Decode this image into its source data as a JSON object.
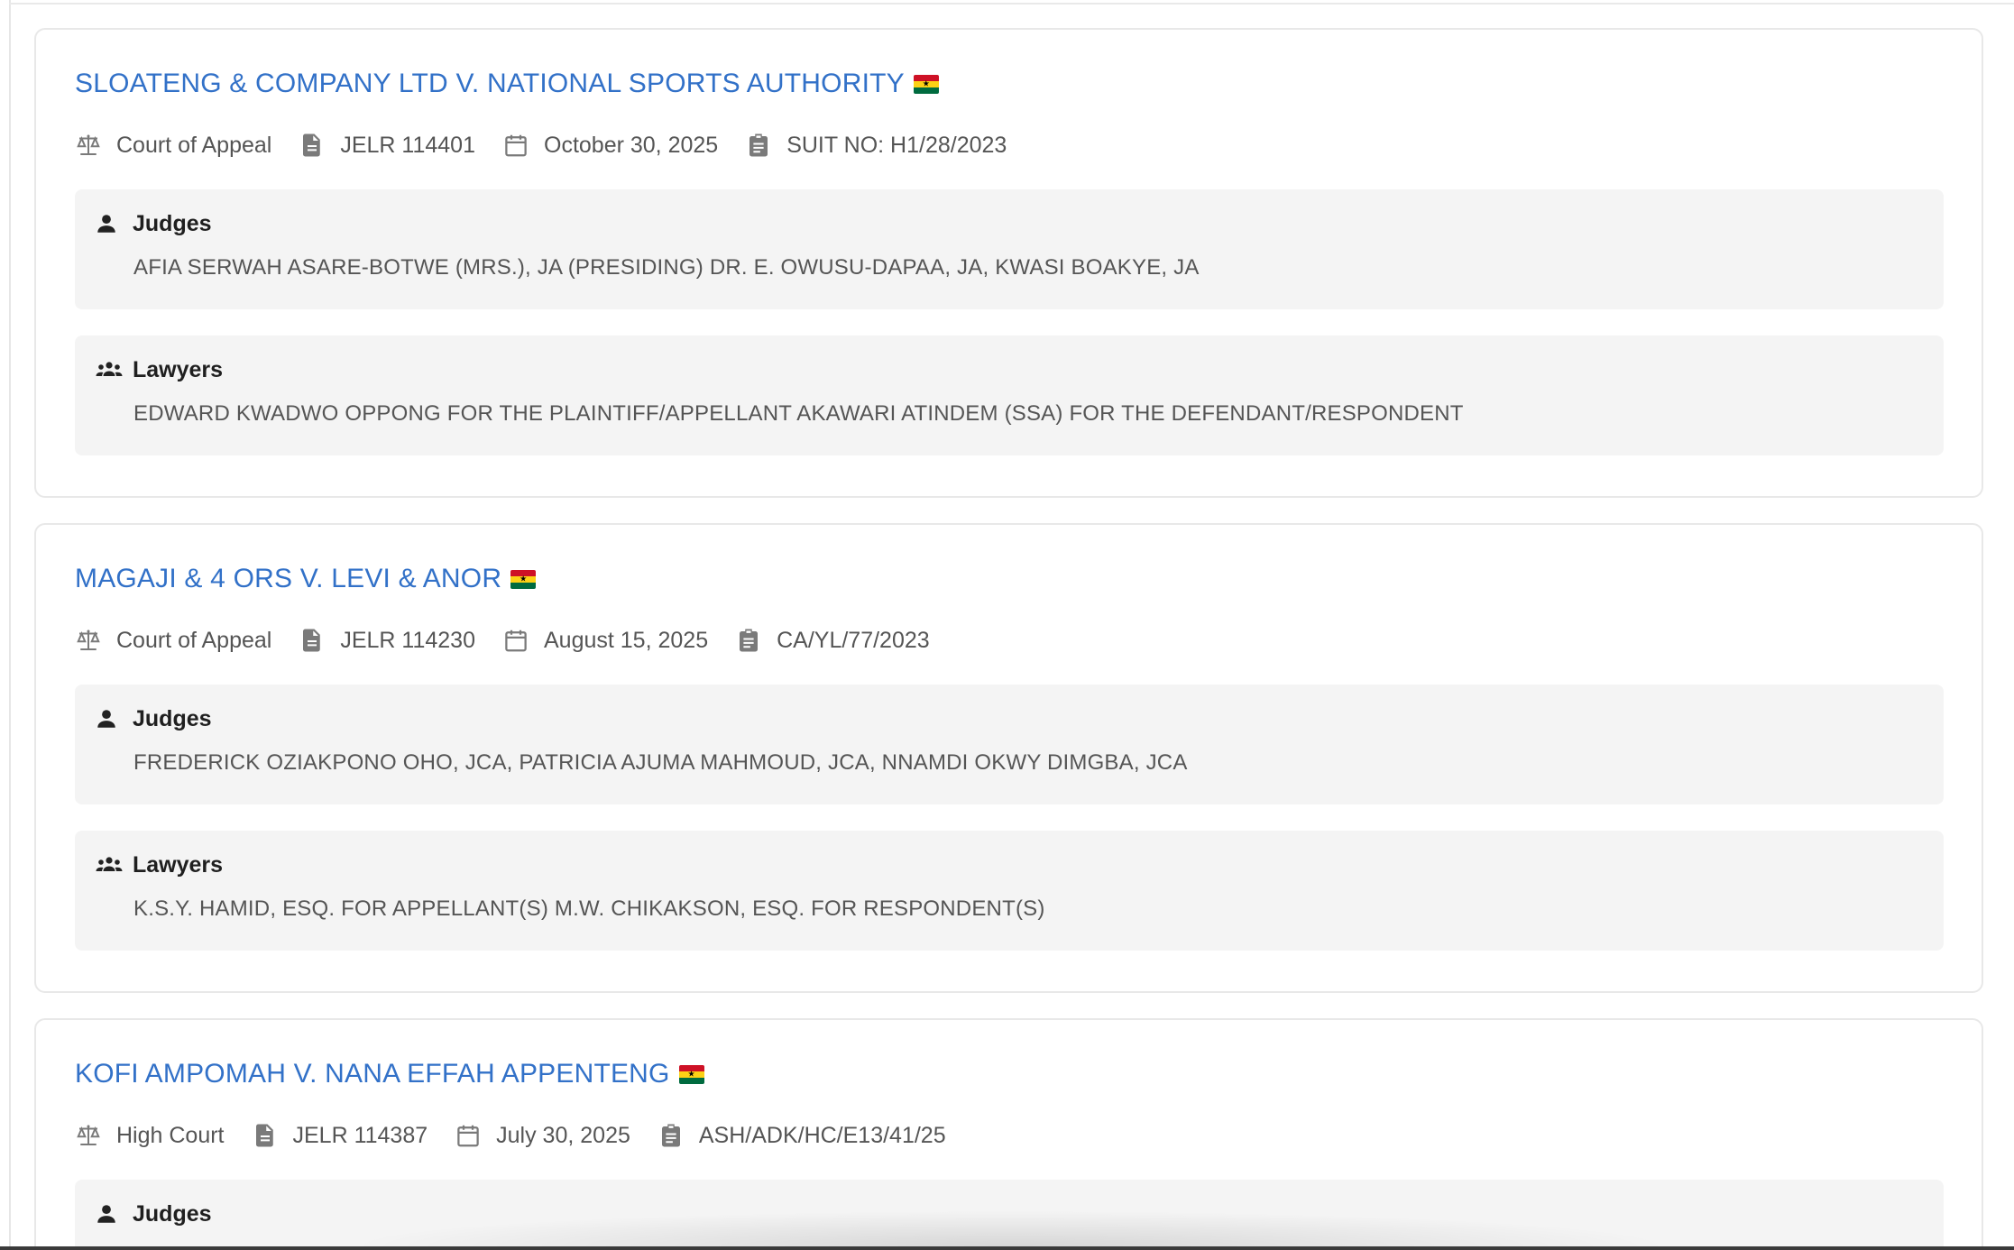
{
  "cases": [
    {
      "title": "SLOATENG & COMPANY LTD V. NATIONAL SPORTS AUTHORITY",
      "court": "Court of Appeal",
      "citation": "JELR 114401",
      "date": "October 30, 2025",
      "suit_no": "SUIT NO: H1/28/2023",
      "judges_label": "Judges",
      "judges": "AFIA SERWAH ASARE-BOTWE (MRS.), JA (PRESIDING) DR. E. OWUSU-DAPAA, JA, KWASI BOAKYE, JA",
      "lawyers_label": "Lawyers",
      "lawyers": "EDWARD KWADWO OPPONG FOR THE PLAINTIFF/APPELLANT AKAWARI ATINDEM (SSA) FOR THE DEFENDANT/RESPONDENT"
    },
    {
      "title": "MAGAJI & 4 ORS V. LEVI & ANOR",
      "court": "Court of Appeal",
      "citation": "JELR 114230",
      "date": "August 15, 2025",
      "suit_no": "CA/YL/77/2023",
      "judges_label": "Judges",
      "judges": "FREDERICK OZIAKPONO OHO, JCA, PATRICIA AJUMA MAHMOUD, JCA, NNAMDI OKWY DIMGBA, JCA",
      "lawyers_label": "Lawyers",
      "lawyers": "K.S.Y. HAMID, ESQ. FOR APPELLANT(S) M.W. CHIKAKSON, ESQ. FOR RESPONDENT(S)"
    },
    {
      "title": "KOFI AMPOMAH V. NANA EFFAH APPENTENG",
      "court": "High Court",
      "citation": "JELR 114387",
      "date": "July 30, 2025",
      "suit_no": "ASH/ADK/HC/E13/41/25",
      "judges_label": "Judges"
    }
  ],
  "icons": {
    "court": "scale-icon",
    "citation": "document-icon",
    "date": "calendar-icon",
    "suit": "clipboard-icon",
    "judges": "person-icon",
    "lawyers": "group-icon",
    "flag": "ghana-flag-icon"
  },
  "colors": {
    "title_link": "#3271c8",
    "panel_bg": "#f4f4f4",
    "meta_text": "#555555"
  }
}
